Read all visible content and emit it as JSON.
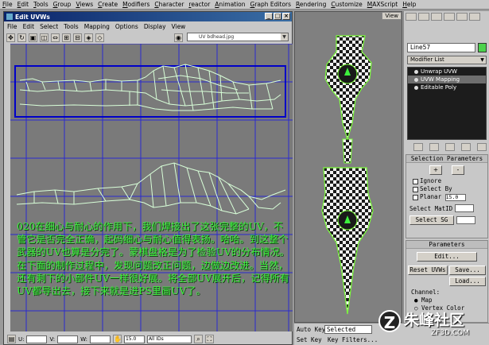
{
  "menubar": [
    "File",
    "Edit",
    "Tools",
    "Group",
    "Views",
    "Create",
    "Modifiers",
    "Character",
    "reactor",
    "Animation",
    "Graph Editors",
    "Rendering",
    "Customize",
    "MAXScript",
    "Help"
  ],
  "uvw_window": {
    "title": "Edit UVWs",
    "menu": [
      "File",
      "Edit",
      "Select",
      "Tools",
      "Mapping",
      "Options",
      "Display",
      "View"
    ],
    "map_selector": "UV  bdhead.jpg",
    "caption": "020在细心与耐心的作用下，我们焊接出了这张完整的UV，不管它是否完全正确，起码细心与耐心值得表扬。哈哈。到这整个武器的UV也算是分完了。蒙棋盘格是为了检验UV的分布情况。在下面的制作过程中，发现问题改正问题，边做边改进。当然，还有剩下的小部件UV一样很好展。将全部UV展开后，记得所有UV都导出去，接下来就是进PS里画UV了。",
    "bottom": {
      "u_label": "U:",
      "v_label": "V:",
      "w_label": "W:",
      "zoom_value": "15.0",
      "id_select": "All IDs"
    }
  },
  "viewport": {
    "label": "View"
  },
  "command_panel": {
    "object_name": "Line57",
    "object_color": "#4cd24c",
    "modifier_list": "Modifier List",
    "stack": [
      {
        "label": "Unwrap UVW",
        "selected": false
      },
      {
        "label": "UVW Mapping",
        "selected": true
      },
      {
        "label": "Editable Poly",
        "selected": false
      }
    ],
    "selection_params": {
      "title": "Selection Parameters",
      "plus": "+",
      "minus": "-",
      "ignore": "Ignore",
      "select_by": "Select By",
      "planar": "Planar",
      "planar_value": "15.0",
      "select_matid": "Select MatID",
      "select_sg": "Select SG"
    },
    "parameters": {
      "title": "Parameters",
      "edit": "Edit...",
      "reset_uvws": "Reset UVWs",
      "save": "Save...",
      "load": "Load...",
      "channel": "Channel:",
      "map": "Map",
      "vertex_color": "Vertex Color"
    }
  },
  "statusbar": {
    "auto_key": "Auto Key",
    "selected": "Selected",
    "set_key": "Set Key",
    "key_filters": "Key Filters..."
  },
  "watermark": {
    "logo": "Z",
    "text": "朱峰社区",
    "url": "ZF3D.COM"
  }
}
